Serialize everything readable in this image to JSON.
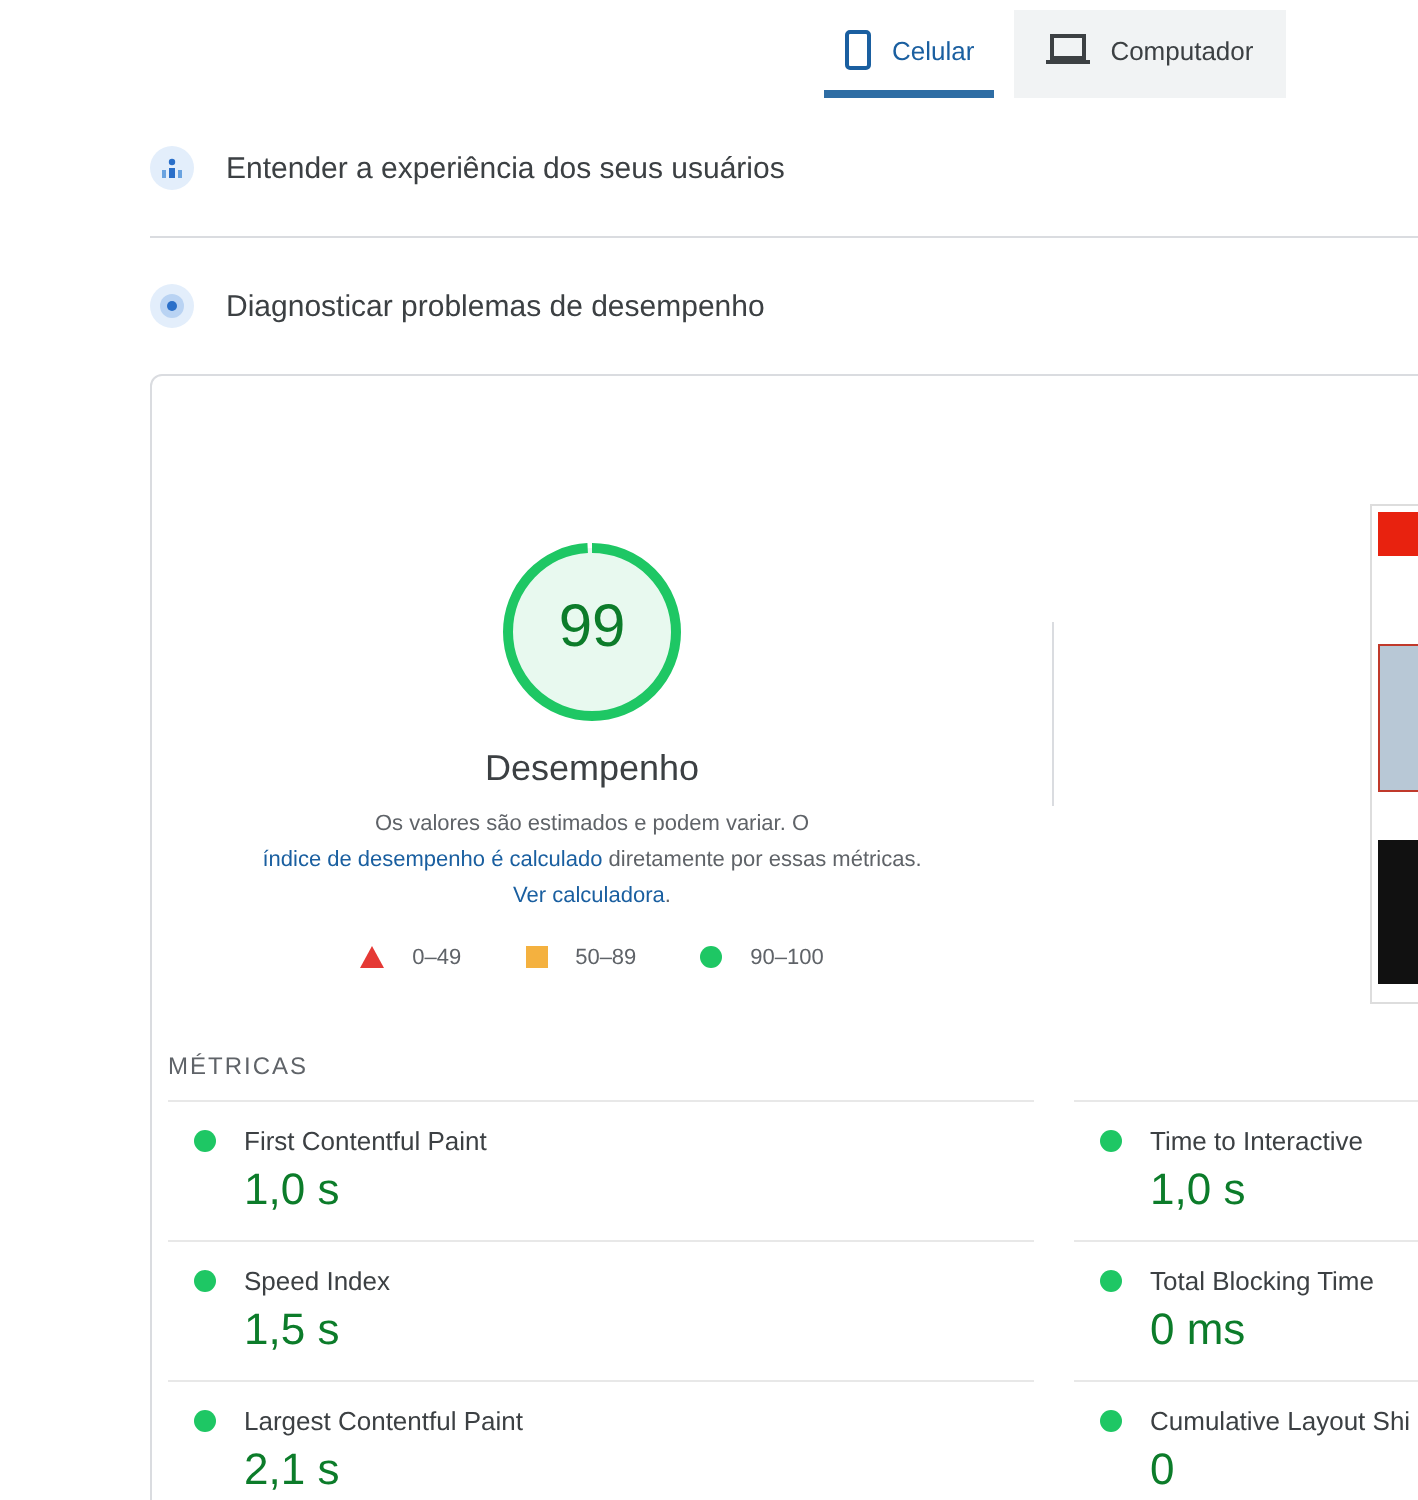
{
  "device_tabs": [
    {
      "label": "Celular",
      "kind": "mobile",
      "selected": true
    },
    {
      "label": "Computador",
      "kind": "desktop",
      "selected": false
    }
  ],
  "sections": [
    {
      "title": "Entender a experiência dos seus usuários",
      "kind": "users"
    },
    {
      "title": "Diagnosticar problemas de desempenho",
      "kind": "diagnose"
    }
  ],
  "score": {
    "value": "99",
    "level": 0.99,
    "color": "#1ec764",
    "label": "Desempenho",
    "note": [
      {
        "text": "Os valores são estimados e podem variar. O ",
        "link": false
      },
      {
        "text": "índice de desempenho é calculado",
        "link": true
      },
      {
        "text": " diretamente por essas métricas. ",
        "link": false
      },
      {
        "text": "Ver calculadora",
        "link": true
      },
      {
        "text": ".",
        "link": false
      }
    ]
  },
  "legend": [
    {
      "kind": "triangle",
      "color": "#e53935",
      "range": "0–49"
    },
    {
      "kind": "square",
      "color": "#f4b13f",
      "range": "50–89"
    },
    {
      "kind": "circle",
      "color": "#1ec764",
      "range": "90–100"
    }
  ],
  "metrics_title": "MÉTRICAS",
  "metrics": [
    {
      "name": "First Contentful Paint",
      "value": "1,0 s",
      "color": "#1ec764"
    },
    {
      "name": "Time to Interactive",
      "value": "1,0 s",
      "color": "#1ec764"
    },
    {
      "name": "Speed Index",
      "value": "1,5 s",
      "color": "#1ec764"
    },
    {
      "name": "Total Blocking Time",
      "value": "0 ms",
      "color": "#1ec764"
    },
    {
      "name": "Largest Contentful Paint",
      "value": "2,1 s",
      "color": "#1ec764"
    },
    {
      "name": "Cumulative Layout Shi",
      "value": "0",
      "color": "#1ec764"
    }
  ]
}
